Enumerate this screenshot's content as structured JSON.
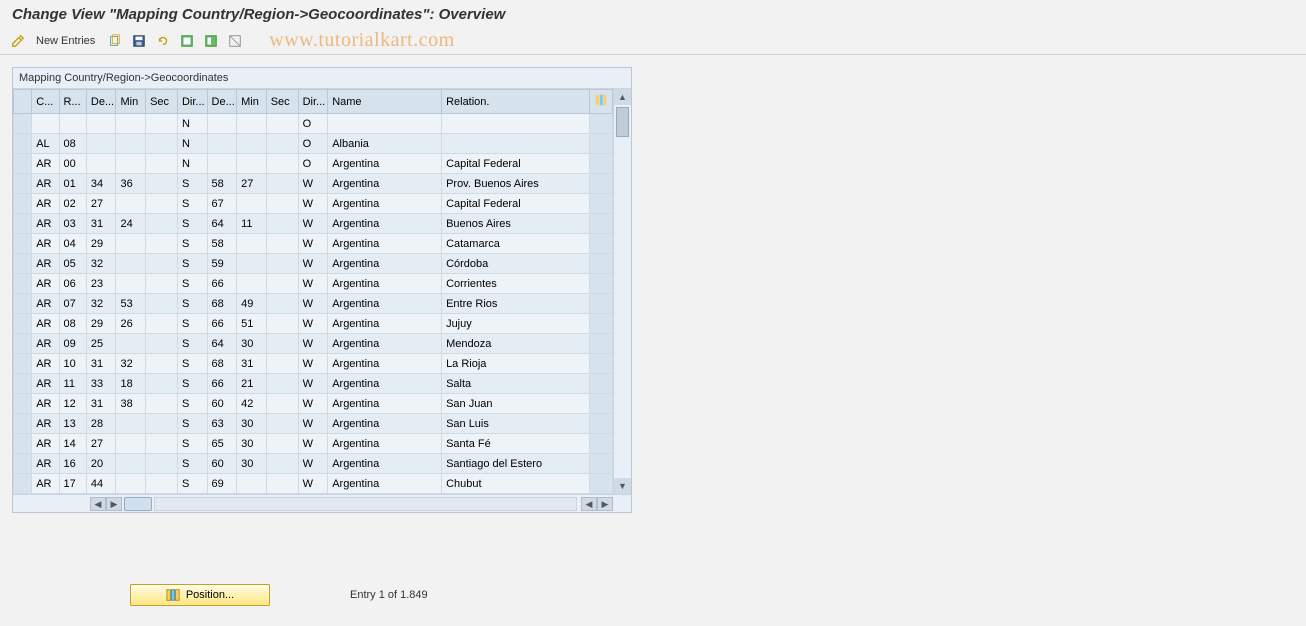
{
  "title": "Change View \"Mapping Country/Region->Geocoordinates\": Overview",
  "toolbar": {
    "new_entries": "New Entries"
  },
  "watermark": "www.tutorialkart.com",
  "panel": {
    "header": "Mapping Country/Region->Geocoordinates"
  },
  "columns": [
    "C...",
    "R...",
    "De...",
    "Min",
    "Sec",
    "Dir...",
    "De...",
    "Min",
    "Sec",
    "Dir...",
    "Name",
    "Relation."
  ],
  "rows": [
    {
      "c": "",
      "r": "",
      "de": "",
      "min": "",
      "sec": "",
      "dir": "N",
      "de2": "",
      "min2": "",
      "sec2": "",
      "dir2": "O",
      "name": "",
      "rel": ""
    },
    {
      "c": "AL",
      "r": "08",
      "de": "",
      "min": "",
      "sec": "",
      "dir": "N",
      "de2": "",
      "min2": "",
      "sec2": "",
      "dir2": "O",
      "name": "Albania",
      "rel": ""
    },
    {
      "c": "AR",
      "r": "00",
      "de": "",
      "min": "",
      "sec": "",
      "dir": "N",
      "de2": "",
      "min2": "",
      "sec2": "",
      "dir2": "O",
      "name": "Argentina",
      "rel": "Capital Federal"
    },
    {
      "c": "AR",
      "r": "01",
      "de": "34",
      "min": "36",
      "sec": "",
      "dir": "S",
      "de2": "58",
      "min2": "27",
      "sec2": "",
      "dir2": "W",
      "name": "Argentina",
      "rel": "Prov. Buenos Aires"
    },
    {
      "c": "AR",
      "r": "02",
      "de": "27",
      "min": "",
      "sec": "",
      "dir": "S",
      "de2": "67",
      "min2": "",
      "sec2": "",
      "dir2": "W",
      "name": "Argentina",
      "rel": "Capital Federal"
    },
    {
      "c": "AR",
      "r": "03",
      "de": "31",
      "min": "24",
      "sec": "",
      "dir": "S",
      "de2": "64",
      "min2": "11",
      "sec2": "",
      "dir2": "W",
      "name": "Argentina",
      "rel": "Buenos Aires"
    },
    {
      "c": "AR",
      "r": "04",
      "de": "29",
      "min": "",
      "sec": "",
      "dir": "S",
      "de2": "58",
      "min2": "",
      "sec2": "",
      "dir2": "W",
      "name": "Argentina",
      "rel": "Catamarca"
    },
    {
      "c": "AR",
      "r": "05",
      "de": "32",
      "min": "",
      "sec": "",
      "dir": "S",
      "de2": "59",
      "min2": "",
      "sec2": "",
      "dir2": "W",
      "name": "Argentina",
      "rel": "Córdoba"
    },
    {
      "c": "AR",
      "r": "06",
      "de": "23",
      "min": "",
      "sec": "",
      "dir": "S",
      "de2": "66",
      "min2": "",
      "sec2": "",
      "dir2": "W",
      "name": "Argentina",
      "rel": "Corrientes"
    },
    {
      "c": "AR",
      "r": "07",
      "de": "32",
      "min": "53",
      "sec": "",
      "dir": "S",
      "de2": "68",
      "min2": "49",
      "sec2": "",
      "dir2": "W",
      "name": "Argentina",
      "rel": "Entre Rios"
    },
    {
      "c": "AR",
      "r": "08",
      "de": "29",
      "min": "26",
      "sec": "",
      "dir": "S",
      "de2": "66",
      "min2": "51",
      "sec2": "",
      "dir2": "W",
      "name": "Argentina",
      "rel": "Jujuy"
    },
    {
      "c": "AR",
      "r": "09",
      "de": "25",
      "min": "",
      "sec": "",
      "dir": "S",
      "de2": "64",
      "min2": "30",
      "sec2": "",
      "dir2": "W",
      "name": "Argentina",
      "rel": "Mendoza"
    },
    {
      "c": "AR",
      "r": "10",
      "de": "31",
      "min": "32",
      "sec": "",
      "dir": "S",
      "de2": "68",
      "min2": "31",
      "sec2": "",
      "dir2": "W",
      "name": "Argentina",
      "rel": "La Rioja"
    },
    {
      "c": "AR",
      "r": "11",
      "de": "33",
      "min": "18",
      "sec": "",
      "dir": "S",
      "de2": "66",
      "min2": "21",
      "sec2": "",
      "dir2": "W",
      "name": "Argentina",
      "rel": "Salta"
    },
    {
      "c": "AR",
      "r": "12",
      "de": "31",
      "min": "38",
      "sec": "",
      "dir": "S",
      "de2": "60",
      "min2": "42",
      "sec2": "",
      "dir2": "W",
      "name": "Argentina",
      "rel": "San Juan"
    },
    {
      "c": "AR",
      "r": "13",
      "de": "28",
      "min": "",
      "sec": "",
      "dir": "S",
      "de2": "63",
      "min2": "30",
      "sec2": "",
      "dir2": "W",
      "name": "Argentina",
      "rel": "San Luis"
    },
    {
      "c": "AR",
      "r": "14",
      "de": "27",
      "min": "",
      "sec": "",
      "dir": "S",
      "de2": "65",
      "min2": "30",
      "sec2": "",
      "dir2": "W",
      "name": "Argentina",
      "rel": "Santa Fé"
    },
    {
      "c": "AR",
      "r": "16",
      "de": "20",
      "min": "",
      "sec": "",
      "dir": "S",
      "de2": "60",
      "min2": "30",
      "sec2": "",
      "dir2": "W",
      "name": "Argentina",
      "rel": "Santiago del Estero"
    },
    {
      "c": "AR",
      "r": "17",
      "de": "44",
      "min": "",
      "sec": "",
      "dir": "S",
      "de2": "69",
      "min2": "",
      "sec2": "",
      "dir2": "W",
      "name": "Argentina",
      "rel": "Chubut"
    }
  ],
  "footer": {
    "position_label": "Position...",
    "entry_label": "Entry 1 of 1.849"
  }
}
